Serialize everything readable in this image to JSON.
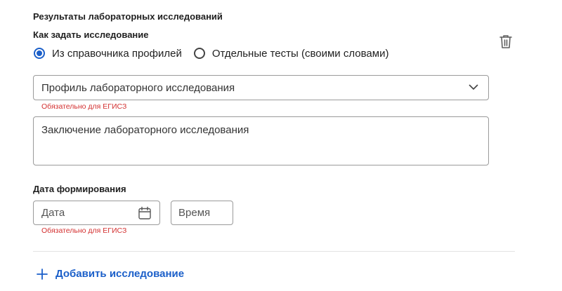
{
  "section": {
    "title": "Результаты лабораторных исследований",
    "how_label": "Как задать исследование"
  },
  "radio": {
    "options": [
      {
        "label": "Из справочника профилей",
        "checked": true
      },
      {
        "label": "Отдельные тесты (своими словами)",
        "checked": false
      }
    ]
  },
  "profile_select": {
    "placeholder": "Профиль лабораторного исследования",
    "error": "Обязательно для ЕГИСЗ"
  },
  "conclusion": {
    "placeholder": "Заключение лабораторного исследования"
  },
  "date_block": {
    "label": "Дата формирования",
    "date_placeholder": "Дата",
    "time_placeholder": "Время",
    "error": "Обязательно для ЕГИСЗ"
  },
  "add_button": {
    "label": "Добавить исследование"
  },
  "colors": {
    "accent": "#1b5fc9",
    "error": "#d32f2f",
    "border": "#9a9a9a"
  },
  "icons": [
    "trash-icon",
    "chevron-down-icon",
    "calendar-icon",
    "plus-icon"
  ]
}
